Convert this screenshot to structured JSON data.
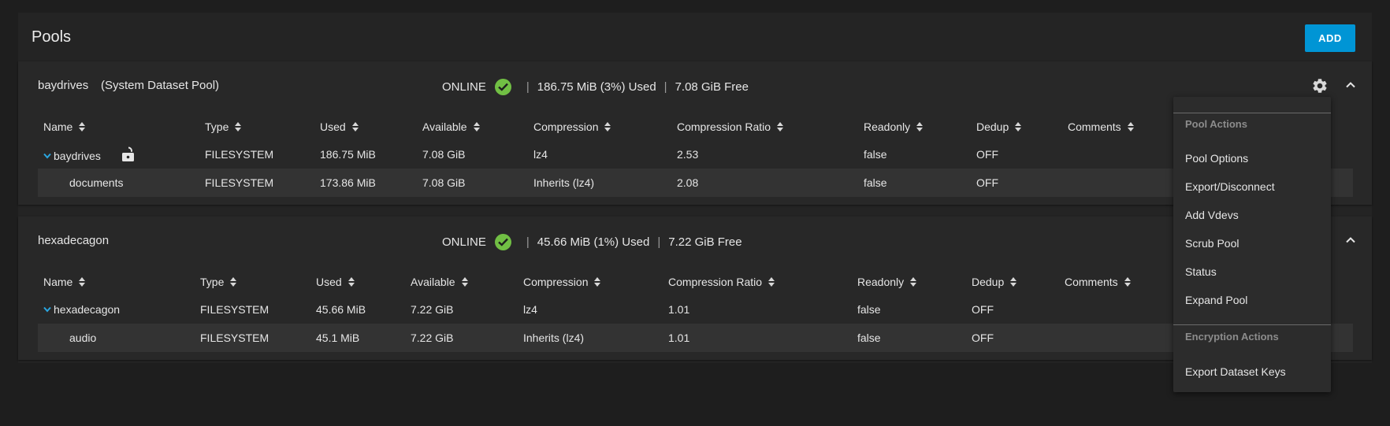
{
  "page": {
    "title": "Pools",
    "add_label": "ADD"
  },
  "columns": {
    "name": "Name",
    "type": "Type",
    "used": "Used",
    "available": "Available",
    "compression": "Compression",
    "ratio": "Compression Ratio",
    "readonly": "Readonly",
    "dedup": "Dedup",
    "comments": "Comments"
  },
  "pools": [
    {
      "name": "baydrives",
      "note": "(System Dataset Pool)",
      "status": "ONLINE",
      "used": "186.75 MiB (3%) Used",
      "free": "7.08 GiB Free",
      "rows": [
        {
          "name": "baydrives",
          "type": "FILESYSTEM",
          "used": "186.75 MiB",
          "available": "7.08 GiB",
          "compression": "lz4",
          "ratio": "2.53",
          "readonly": "false",
          "dedup": "OFF",
          "comments": ""
        },
        {
          "name": "documents",
          "type": "FILESYSTEM",
          "used": "173.86 MiB",
          "available": "7.08 GiB",
          "compression": "Inherits (lz4)",
          "ratio": "2.08",
          "readonly": "false",
          "dedup": "OFF",
          "comments": ""
        }
      ]
    },
    {
      "name": "hexadecagon",
      "note": "",
      "status": "ONLINE",
      "used": "45.66 MiB (1%) Used",
      "free": "7.22 GiB Free",
      "rows": [
        {
          "name": "hexadecagon",
          "type": "FILESYSTEM",
          "used": "45.66 MiB",
          "available": "7.22 GiB",
          "compression": "lz4",
          "ratio": "1.01",
          "readonly": "false",
          "dedup": "OFF",
          "comments": ""
        },
        {
          "name": "audio",
          "type": "FILESYSTEM",
          "used": "45.1 MiB",
          "available": "7.22 GiB",
          "compression": "Inherits (lz4)",
          "ratio": "1.01",
          "readonly": "false",
          "dedup": "OFF",
          "comments": ""
        }
      ]
    }
  ],
  "menu": {
    "pool_actions_label": "Pool Actions",
    "pool_actions": [
      "Pool Options",
      "Export/Disconnect",
      "Add Vdevs",
      "Scrub Pool",
      "Status",
      "Expand Pool"
    ],
    "encryption_actions_label": "Encryption Actions",
    "encryption_actions": [
      "Export Dataset Keys"
    ]
  },
  "colors": {
    "accent": "#0095d5",
    "online": "#71bf44",
    "background": "#1e1e1e",
    "card": "#282828"
  }
}
